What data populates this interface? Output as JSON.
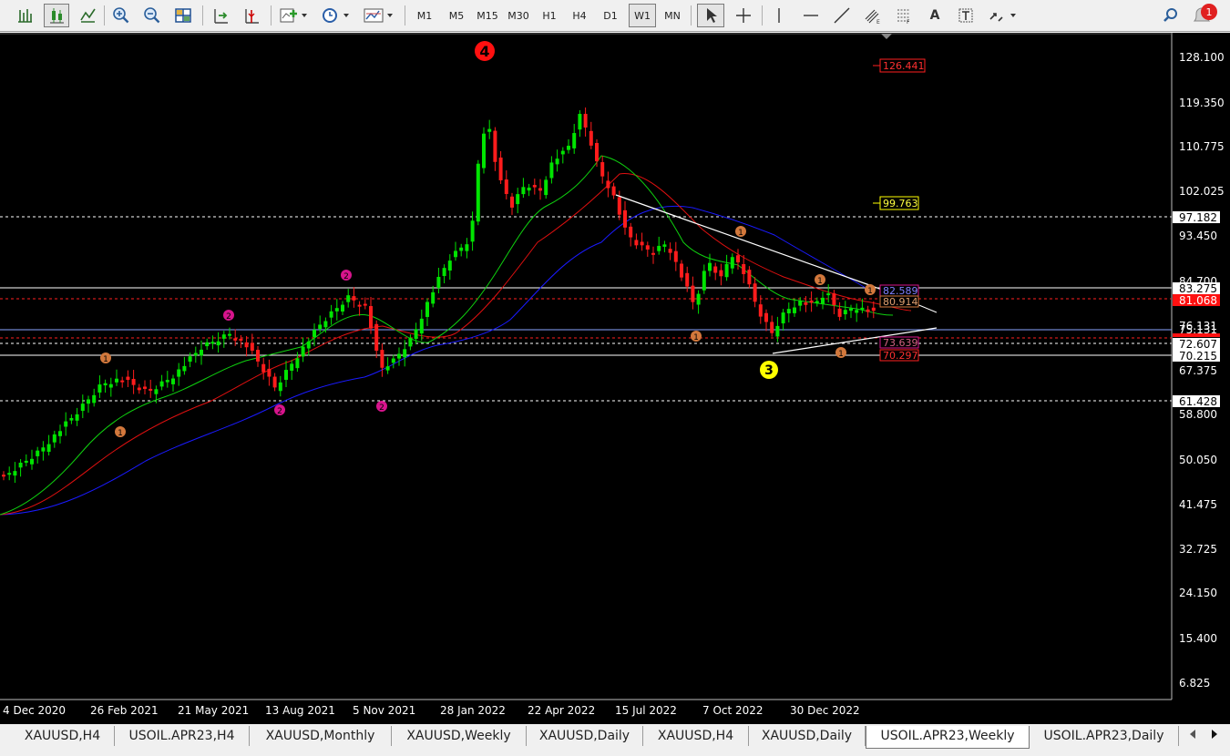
{
  "toolbar": {
    "timeframes": [
      "M1",
      "M5",
      "M15",
      "M30",
      "H1",
      "H4",
      "D1",
      "W1",
      "MN"
    ],
    "active_timeframe": "W1",
    "text_tool": "A",
    "notification_count": "1"
  },
  "chart": {
    "background": "#000000",
    "price_axis": [
      "128.100",
      "119.350",
      "110.775",
      "102.025",
      "93.450",
      "84.700",
      "76.131",
      "67.375",
      "58.800",
      "50.050",
      "41.475",
      "32.725",
      "24.150",
      "15.400",
      "6.825"
    ],
    "time_axis": [
      "4 Dec 2020",
      "26 Feb 2021",
      "21 May 2021",
      "13 Aug 2021",
      "5 Nov 2021",
      "28 Jan 2022",
      "22 Apr 2022",
      "15 Jul 2022",
      "7 Oct 2022",
      "30 Dec 2022"
    ],
    "level_labels": {
      "l126": "126.441",
      "l99": "99.763",
      "l97": "97.182",
      "l83": "83.275",
      "l82": "82.589",
      "l81": "81.068",
      "l80": "80.914",
      "l75": "75.131",
      "l73": "73.639",
      "l72": "72.607",
      "l70a": "70.215",
      "l70b": "70.297",
      "l61": "61.428"
    },
    "wave_labels": {
      "four": "4",
      "three": "3",
      "two": "2",
      "one": "1"
    },
    "colors": {
      "bull": "#00e400",
      "bear": "#ff1c1c",
      "ma_fast": "#0fd10f",
      "ma_mid": "#e01010",
      "ma_slow": "#1a1aff",
      "wave_two": "#d7148c",
      "wave_one": "#d2783c"
    }
  },
  "tabs": [
    "XAUUSD,H4",
    "USOIL.APR23,H4",
    "XAUUSD,Monthly",
    "XAUUSD,Weekly",
    "XAUUSD,Daily",
    "XAUUSD,H4",
    "XAUUSD,Daily",
    "USOIL.APR23,Weekly",
    "USOIL.APR23,Daily"
  ],
  "active_tab": "USOIL.APR23,Weekly"
}
